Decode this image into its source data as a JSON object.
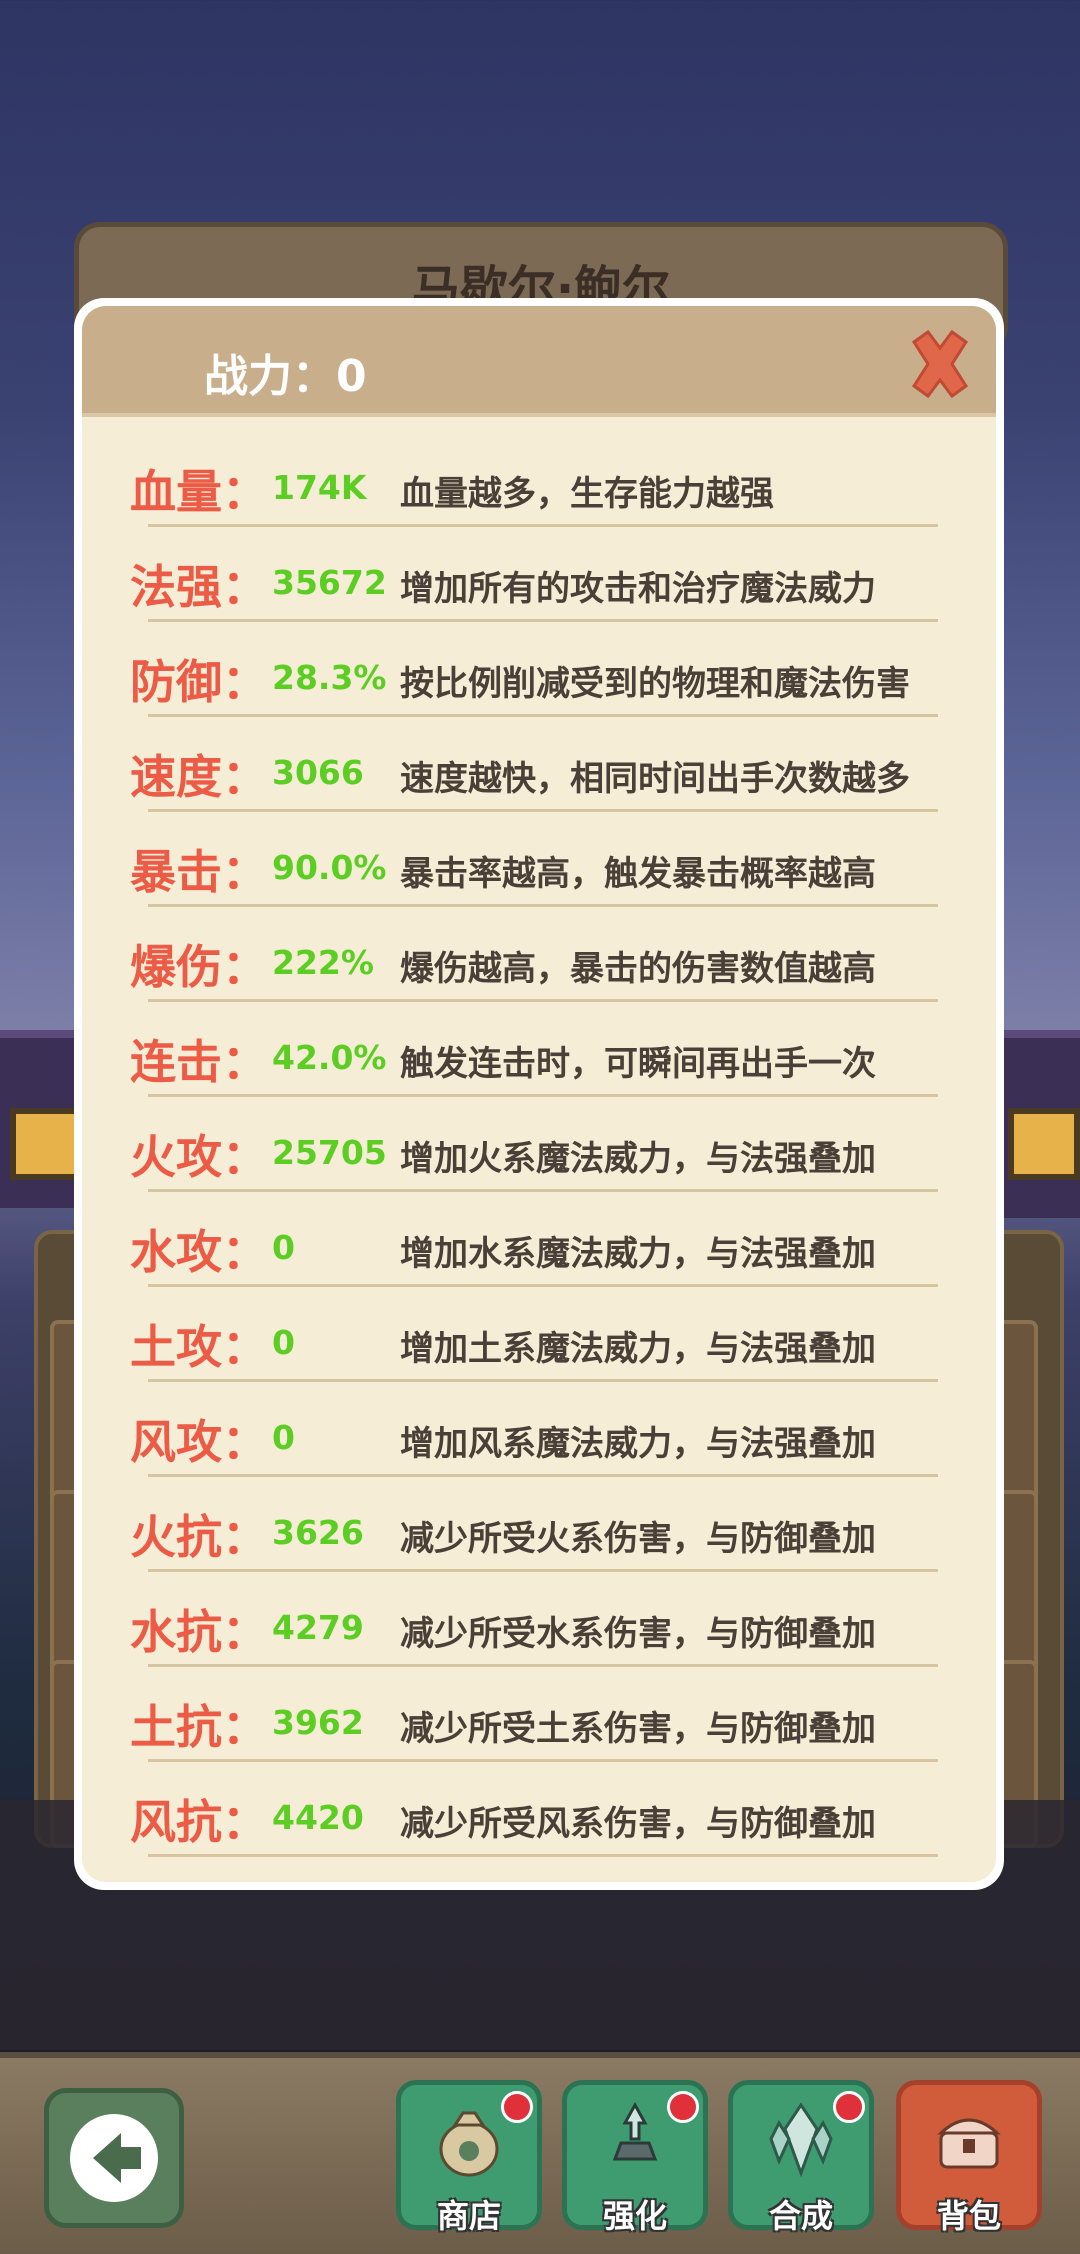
{
  "hero": {
    "name": "马歇尔·鲍尔"
  },
  "modal": {
    "power_label": "战力：0",
    "close_icon": "close-x-icon"
  },
  "stats": [
    {
      "name": "血量：",
      "value": "174K",
      "desc": "血量越多，生存能力越强"
    },
    {
      "name": "法强：",
      "value": "35672",
      "desc": "增加所有的攻击和治疗魔法威力"
    },
    {
      "name": "防御：",
      "value": "28.3%",
      "desc": "按比例削减受到的物理和魔法伤害"
    },
    {
      "name": "速度：",
      "value": "3066",
      "desc": "速度越快，相同时间出手次数越多"
    },
    {
      "name": "暴击：",
      "value": "90.0%",
      "desc": "暴击率越高，触发暴击概率越高"
    },
    {
      "name": "爆伤：",
      "value": "222%",
      "desc": "爆伤越高，暴击的伤害数值越高"
    },
    {
      "name": "连击：",
      "value": "42.0%",
      "desc": "触发连击时，可瞬间再出手一次"
    },
    {
      "name": "火攻：",
      "value": "25705",
      "desc": "增加火系魔法威力，与法强叠加"
    },
    {
      "name": "水攻：",
      "value": "0",
      "desc": "增加水系魔法威力，与法强叠加"
    },
    {
      "name": "土攻：",
      "value": "0",
      "desc": "增加土系魔法威力，与法强叠加"
    },
    {
      "name": "风攻：",
      "value": "0",
      "desc": "增加风系魔法威力，与法强叠加"
    },
    {
      "name": "火抗：",
      "value": "3626",
      "desc": "减少所受火系伤害，与防御叠加"
    },
    {
      "name": "水抗：",
      "value": "4279",
      "desc": "减少所受水系伤害，与防御叠加"
    },
    {
      "name": "土抗：",
      "value": "3962",
      "desc": "减少所受土系伤害，与防御叠加"
    },
    {
      "name": "风抗：",
      "value": "4420",
      "desc": "减少所受风系伤害，与防御叠加"
    }
  ],
  "bottom_nav": {
    "back_icon": "back-arrow-icon",
    "shop_label": "商店",
    "enhance_label": "强化",
    "synth_label": "合成",
    "bag_label": "背包"
  },
  "colors": {
    "stat_name": "#ec5b45",
    "stat_value": "#5ccd22",
    "stat_desc": "#4a4038",
    "modal_bg": "#f5edd6",
    "header_bg": "#c9ae8c"
  }
}
